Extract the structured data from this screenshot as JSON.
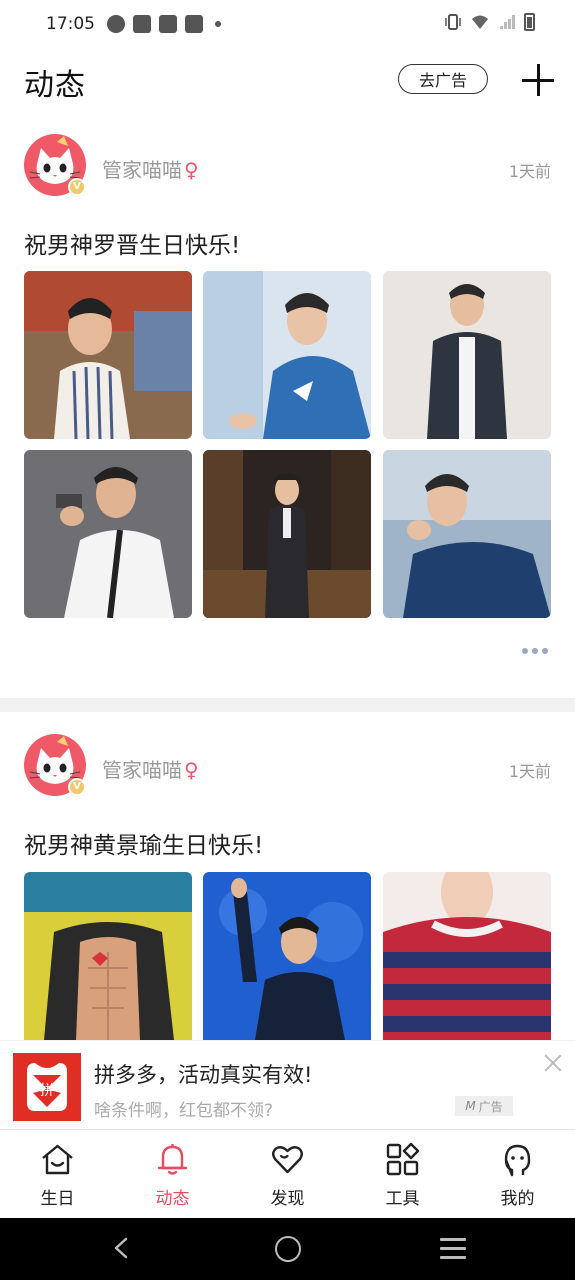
{
  "status_bar": {
    "time": "17:05",
    "icons": [
      "clock-icon",
      "mail-icon",
      "mail-icon",
      "mail-icon",
      "dot-icon",
      "vibrate-icon",
      "wifi-icon",
      "signal-icon",
      "battery-icon"
    ]
  },
  "header": {
    "title": "动态",
    "ad_button_label": "去广告",
    "add_icon": "plus-icon"
  },
  "posts": [
    {
      "username": "管家喵喵",
      "gender_symbol": "♀",
      "time": "1天前",
      "text": "祝男神罗晋生日快乐!",
      "photos": 6,
      "more_icon": "more-dots-icon"
    },
    {
      "username": "管家喵喵",
      "gender_symbol": "♀",
      "time": "1天前",
      "text": "祝男神黄景瑜生日快乐!",
      "photos": 3
    }
  ],
  "ad": {
    "title": "拼多多，活动真实有效!",
    "subtitle": "啥条件啊，红包都不领?",
    "tag": "广告",
    "logo_text": "拼"
  },
  "bottom_nav": {
    "items": [
      {
        "label": "生日",
        "icon": "house-icon"
      },
      {
        "label": "动态",
        "icon": "bell-icon",
        "active": true
      },
      {
        "label": "发现",
        "icon": "heart-icon"
      },
      {
        "label": "工具",
        "icon": "grid-icon"
      },
      {
        "label": "我的",
        "icon": "profile-face-icon"
      }
    ]
  },
  "colors": {
    "accent": "#e84a5f",
    "gender": "#f0566b",
    "ad_brand": "#e02e24",
    "muted_text": "#9a9a9a"
  }
}
